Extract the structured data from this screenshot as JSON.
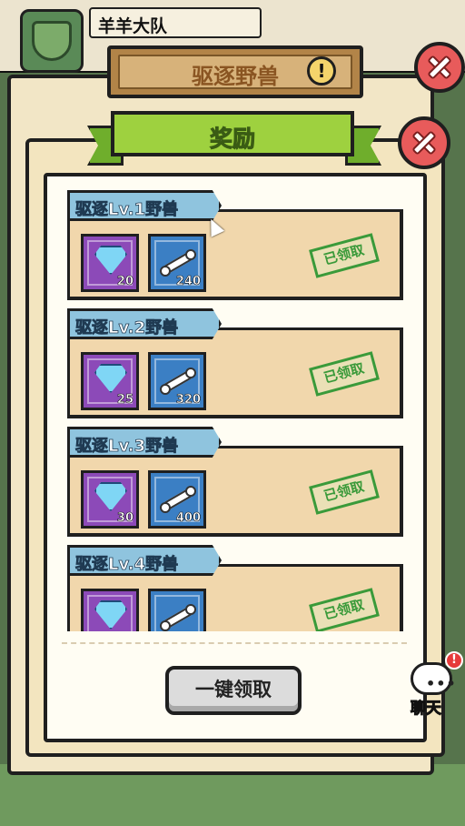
{
  "team": {
    "name": "羊羊大队"
  },
  "outer_panel": {
    "title": "驱逐野兽",
    "info_symbol": "!"
  },
  "inner_panel": {
    "title": "奖励"
  },
  "rewards": [
    {
      "label": "驱逐Lv.1野兽",
      "gem_qty": "20",
      "bone_qty": "240",
      "status": "已领取"
    },
    {
      "label": "驱逐Lv.2野兽",
      "gem_qty": "25",
      "bone_qty": "320",
      "status": "已领取"
    },
    {
      "label": "驱逐Lv.3野兽",
      "gem_qty": "30",
      "bone_qty": "400",
      "status": "已领取"
    },
    {
      "label": "驱逐Lv.4野兽",
      "gem_qty": "",
      "bone_qty": "",
      "status": "已领取"
    }
  ],
  "claim_all_label": "一键领取",
  "chat": {
    "label": "聊天",
    "dots": "•••",
    "badge": "!"
  },
  "icons": [
    "team-badge-icon",
    "info-icon",
    "close-icon",
    "gem-icon",
    "bone-icon",
    "chat-icon",
    "cursor-icon"
  ],
  "colors": {
    "inner_title_green": "#9ed13f",
    "card_header_blue": "#8fc4de",
    "gem_slot_purple": "#8c4ab8",
    "bone_slot_blue": "#3b7fc4",
    "stamp_green": "#3a9a3a",
    "close_red": "#e85b5b"
  }
}
